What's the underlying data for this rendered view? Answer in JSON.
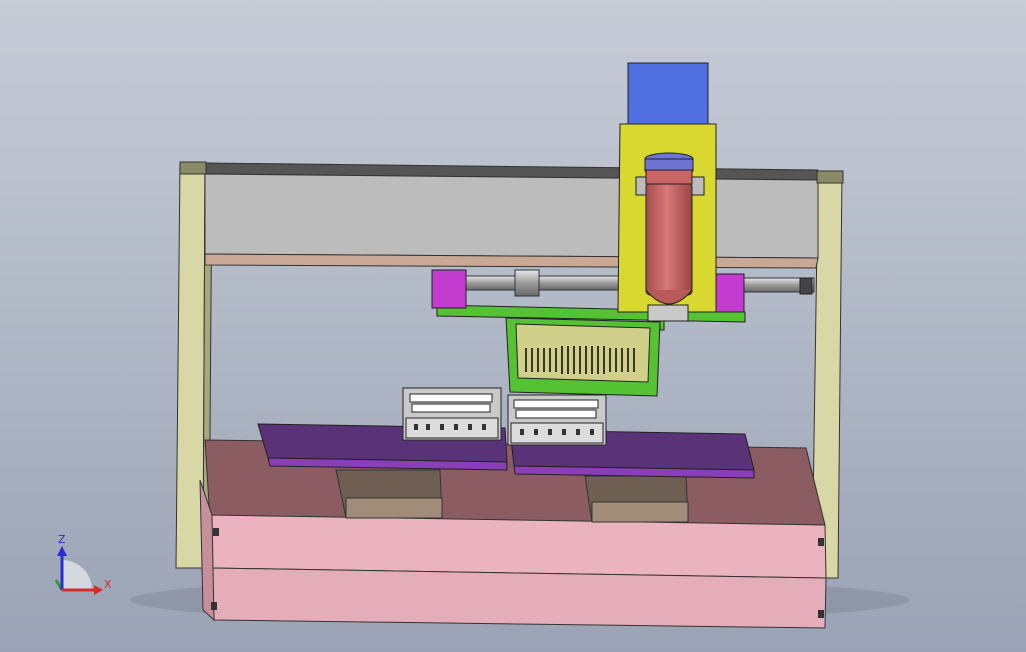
{
  "viewport": {
    "background_top": "#c7ccd7",
    "background_bottom": "#9aa3b5"
  },
  "triad": {
    "z_label": "Z",
    "x_label": "X",
    "z_color": "#2b2bd6",
    "x_color": "#d62b2b",
    "y_color": "#2f9a2f"
  },
  "colors": {
    "frame": "#d8d8a6",
    "beam": "#bcbcbc",
    "gantry_plate": "#55c234",
    "motor_block": "#c43bd0",
    "carriage": "#d8d830",
    "stepper": "#4f6fe0",
    "cylinder": "#c86464",
    "cylinder_cap": "#6e74d4",
    "board": "#5a3278",
    "board_edge": "#8a3fb8",
    "base_top": "#8b5c62",
    "base_side": "#eab3bf",
    "block": "#a08c78",
    "fixture": "#c9c9c9"
  }
}
